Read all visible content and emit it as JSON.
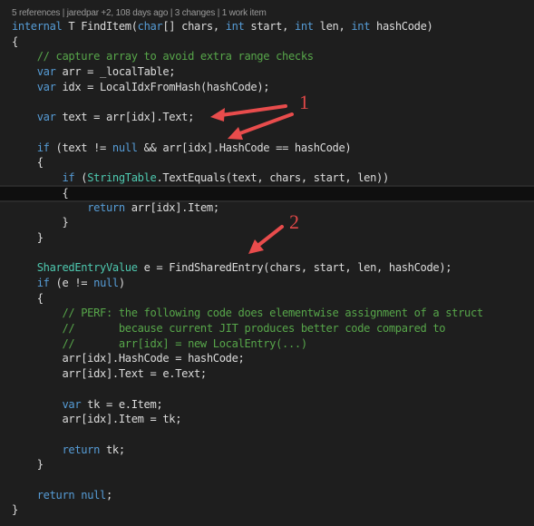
{
  "codelens": {
    "references": "5 references",
    "authors": "jaredpar +2, 108 days ago",
    "changes": "3 changes",
    "work_items": "1 work item",
    "separator": " | "
  },
  "code_lines": [
    {
      "tokens": [
        {
          "t": "internal",
          "c": "kw"
        },
        {
          "t": " T FindItem(",
          "c": "tx"
        },
        {
          "t": "char",
          "c": "kw"
        },
        {
          "t": "[] chars, ",
          "c": "tx"
        },
        {
          "t": "int",
          "c": "kw"
        },
        {
          "t": " start, ",
          "c": "tx"
        },
        {
          "t": "int",
          "c": "kw"
        },
        {
          "t": " len, ",
          "c": "tx"
        },
        {
          "t": "int",
          "c": "kw"
        },
        {
          "t": " hashCode)",
          "c": "tx"
        }
      ]
    },
    {
      "tokens": [
        {
          "t": "{",
          "c": "tx"
        }
      ]
    },
    {
      "tokens": [
        {
          "t": "    // capture array to avoid extra range checks",
          "c": "cm"
        }
      ]
    },
    {
      "tokens": [
        {
          "t": "    ",
          "c": "tx"
        },
        {
          "t": "var",
          "c": "kw"
        },
        {
          "t": " arr = _localTable;",
          "c": "tx"
        }
      ]
    },
    {
      "tokens": [
        {
          "t": "    ",
          "c": "tx"
        },
        {
          "t": "var",
          "c": "kw"
        },
        {
          "t": " idx = LocalIdxFromHash(hashCode);",
          "c": "tx"
        }
      ]
    },
    {
      "tokens": []
    },
    {
      "tokens": [
        {
          "t": "    ",
          "c": "tx"
        },
        {
          "t": "var",
          "c": "kw"
        },
        {
          "t": " text = arr[idx].Text;",
          "c": "tx"
        }
      ]
    },
    {
      "tokens": []
    },
    {
      "tokens": [
        {
          "t": "    ",
          "c": "tx"
        },
        {
          "t": "if",
          "c": "kw"
        },
        {
          "t": " (text != ",
          "c": "tx"
        },
        {
          "t": "null",
          "c": "kw"
        },
        {
          "t": " && arr[idx].HashCode == hashCode)",
          "c": "tx"
        }
      ]
    },
    {
      "tokens": [
        {
          "t": "    {",
          "c": "tx"
        }
      ]
    },
    {
      "tokens": [
        {
          "t": "        ",
          "c": "tx"
        },
        {
          "t": "if",
          "c": "kw"
        },
        {
          "t": " (",
          "c": "tx"
        },
        {
          "t": "StringTable",
          "c": "ty"
        },
        {
          "t": ".TextEquals(text, chars, start, len))",
          "c": "tx"
        }
      ]
    },
    {
      "tokens": [
        {
          "t": "        {",
          "c": "tx"
        }
      ],
      "current": true
    },
    {
      "tokens": [
        {
          "t": "            ",
          "c": "tx"
        },
        {
          "t": "return",
          "c": "kw"
        },
        {
          "t": " arr[idx].Item;",
          "c": "tx"
        }
      ]
    },
    {
      "tokens": [
        {
          "t": "        }",
          "c": "tx"
        }
      ]
    },
    {
      "tokens": [
        {
          "t": "    }",
          "c": "tx"
        }
      ]
    },
    {
      "tokens": []
    },
    {
      "tokens": [
        {
          "t": "    ",
          "c": "tx"
        },
        {
          "t": "SharedEntryValue",
          "c": "ty"
        },
        {
          "t": " e = FindSharedEntry(chars, start, len, hashCode);",
          "c": "tx"
        }
      ]
    },
    {
      "tokens": [
        {
          "t": "    ",
          "c": "tx"
        },
        {
          "t": "if",
          "c": "kw"
        },
        {
          "t": " (e != ",
          "c": "tx"
        },
        {
          "t": "null",
          "c": "kw"
        },
        {
          "t": ")",
          "c": "tx"
        }
      ]
    },
    {
      "tokens": [
        {
          "t": "    {",
          "c": "tx"
        }
      ]
    },
    {
      "tokens": [
        {
          "t": "        // PERF: the following code does elementwise assignment of a struct",
          "c": "cm"
        }
      ]
    },
    {
      "tokens": [
        {
          "t": "        //       because current JIT produces better code compared to",
          "c": "cm"
        }
      ]
    },
    {
      "tokens": [
        {
          "t": "        //       arr[idx] = new LocalEntry(...)",
          "c": "cm"
        }
      ]
    },
    {
      "tokens": [
        {
          "t": "        arr[idx].HashCode = hashCode;",
          "c": "tx"
        }
      ]
    },
    {
      "tokens": [
        {
          "t": "        arr[idx].Text = e.Text;",
          "c": "tx"
        }
      ]
    },
    {
      "tokens": []
    },
    {
      "tokens": [
        {
          "t": "        ",
          "c": "tx"
        },
        {
          "t": "var",
          "c": "kw"
        },
        {
          "t": " tk = e.Item;",
          "c": "tx"
        }
      ]
    },
    {
      "tokens": [
        {
          "t": "        arr[idx].Item = tk;",
          "c": "tx"
        }
      ]
    },
    {
      "tokens": []
    },
    {
      "tokens": [
        {
          "t": "        ",
          "c": "tx"
        },
        {
          "t": "return",
          "c": "kw"
        },
        {
          "t": " tk;",
          "c": "tx"
        }
      ]
    },
    {
      "tokens": [
        {
          "t": "    }",
          "c": "tx"
        }
      ]
    },
    {
      "tokens": []
    },
    {
      "tokens": [
        {
          "t": "    ",
          "c": "tx"
        },
        {
          "t": "return",
          "c": "kw"
        },
        {
          "t": " ",
          "c": "tx"
        },
        {
          "t": "null",
          "c": "kw"
        },
        {
          "t": ";",
          "c": "tx"
        }
      ]
    },
    {
      "tokens": [
        {
          "t": "}",
          "c": "tx"
        }
      ]
    }
  ],
  "annotations": {
    "label_1": "1",
    "label_2": "2",
    "arrow_color": "#e84c4c"
  },
  "colors": {
    "background": "#1e1e1e",
    "keyword": "#569cd6",
    "type": "#4ec9b0",
    "comment": "#57a64a",
    "text": "#dcdcdc",
    "codelens": "#999999"
  }
}
